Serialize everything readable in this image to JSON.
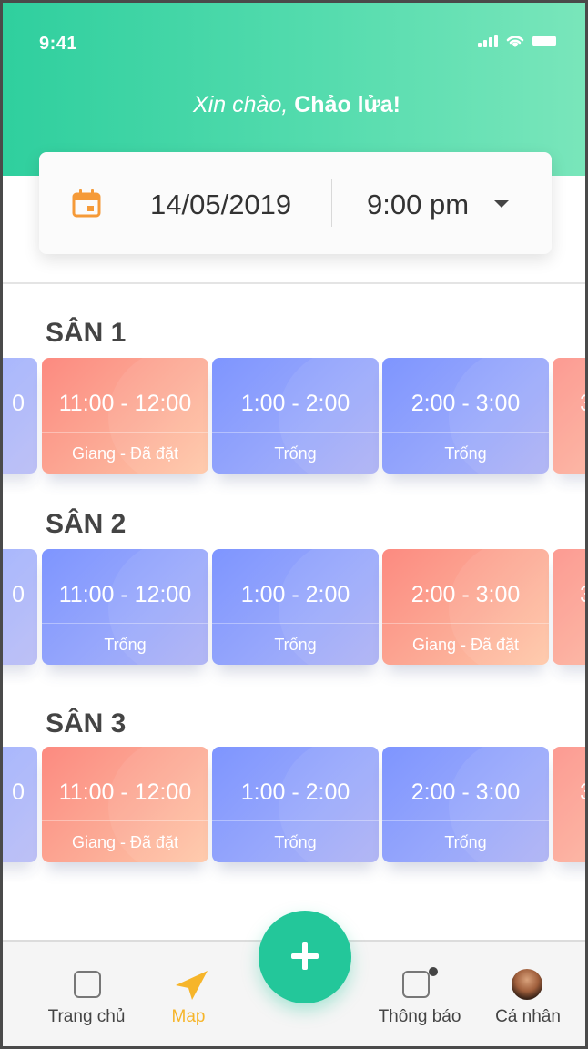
{
  "status_bar": {
    "time": "9:41"
  },
  "greeting": {
    "prefix": "Xin chào, ",
    "name": "Chảo lửa!"
  },
  "picker": {
    "date": "14/05/2019",
    "time": "9:00 pm"
  },
  "courts": [
    {
      "title": "SÂN 1",
      "slots": [
        {
          "range": "0",
          "status": "",
          "kind": "free"
        },
        {
          "range": "11:00 - 12:00",
          "status": "Giang - Đã đặt",
          "kind": "booked"
        },
        {
          "range": "1:00 - 2:00",
          "status": "Trống",
          "kind": "free"
        },
        {
          "range": "2:00 - 3:00",
          "status": "Trống",
          "kind": "free"
        },
        {
          "range": "3",
          "status": "",
          "kind": "booked"
        }
      ]
    },
    {
      "title": "SÂN 2",
      "slots": [
        {
          "range": "0",
          "status": "",
          "kind": "free"
        },
        {
          "range": "11:00 - 12:00",
          "status": "Trống",
          "kind": "free"
        },
        {
          "range": "1:00 - 2:00",
          "status": "Trống",
          "kind": "free"
        },
        {
          "range": "2:00 - 3:00",
          "status": "Giang - Đã đặt",
          "kind": "booked"
        },
        {
          "range": "3",
          "status": "",
          "kind": "booked"
        }
      ]
    },
    {
      "title": "SÂN 3",
      "slots": [
        {
          "range": "0",
          "status": "",
          "kind": "free"
        },
        {
          "range": "11:00 - 12:00",
          "status": "Giang - Đã đặt",
          "kind": "booked"
        },
        {
          "range": "1:00 - 2:00",
          "status": "Trống",
          "kind": "free"
        },
        {
          "range": "2:00 - 3:00",
          "status": "Trống",
          "kind": "free"
        },
        {
          "range": "3",
          "status": "",
          "kind": "booked"
        }
      ]
    }
  ],
  "tabbar": {
    "home": "Trang chủ",
    "map": "Map",
    "notifications": "Thông báo",
    "profile": "Cá nhân"
  },
  "colors": {
    "accent": "#23c79a",
    "active_tab": "#f6b52a",
    "free_slot": "#8a9dfc",
    "booked_slot": "#fc9a88"
  }
}
